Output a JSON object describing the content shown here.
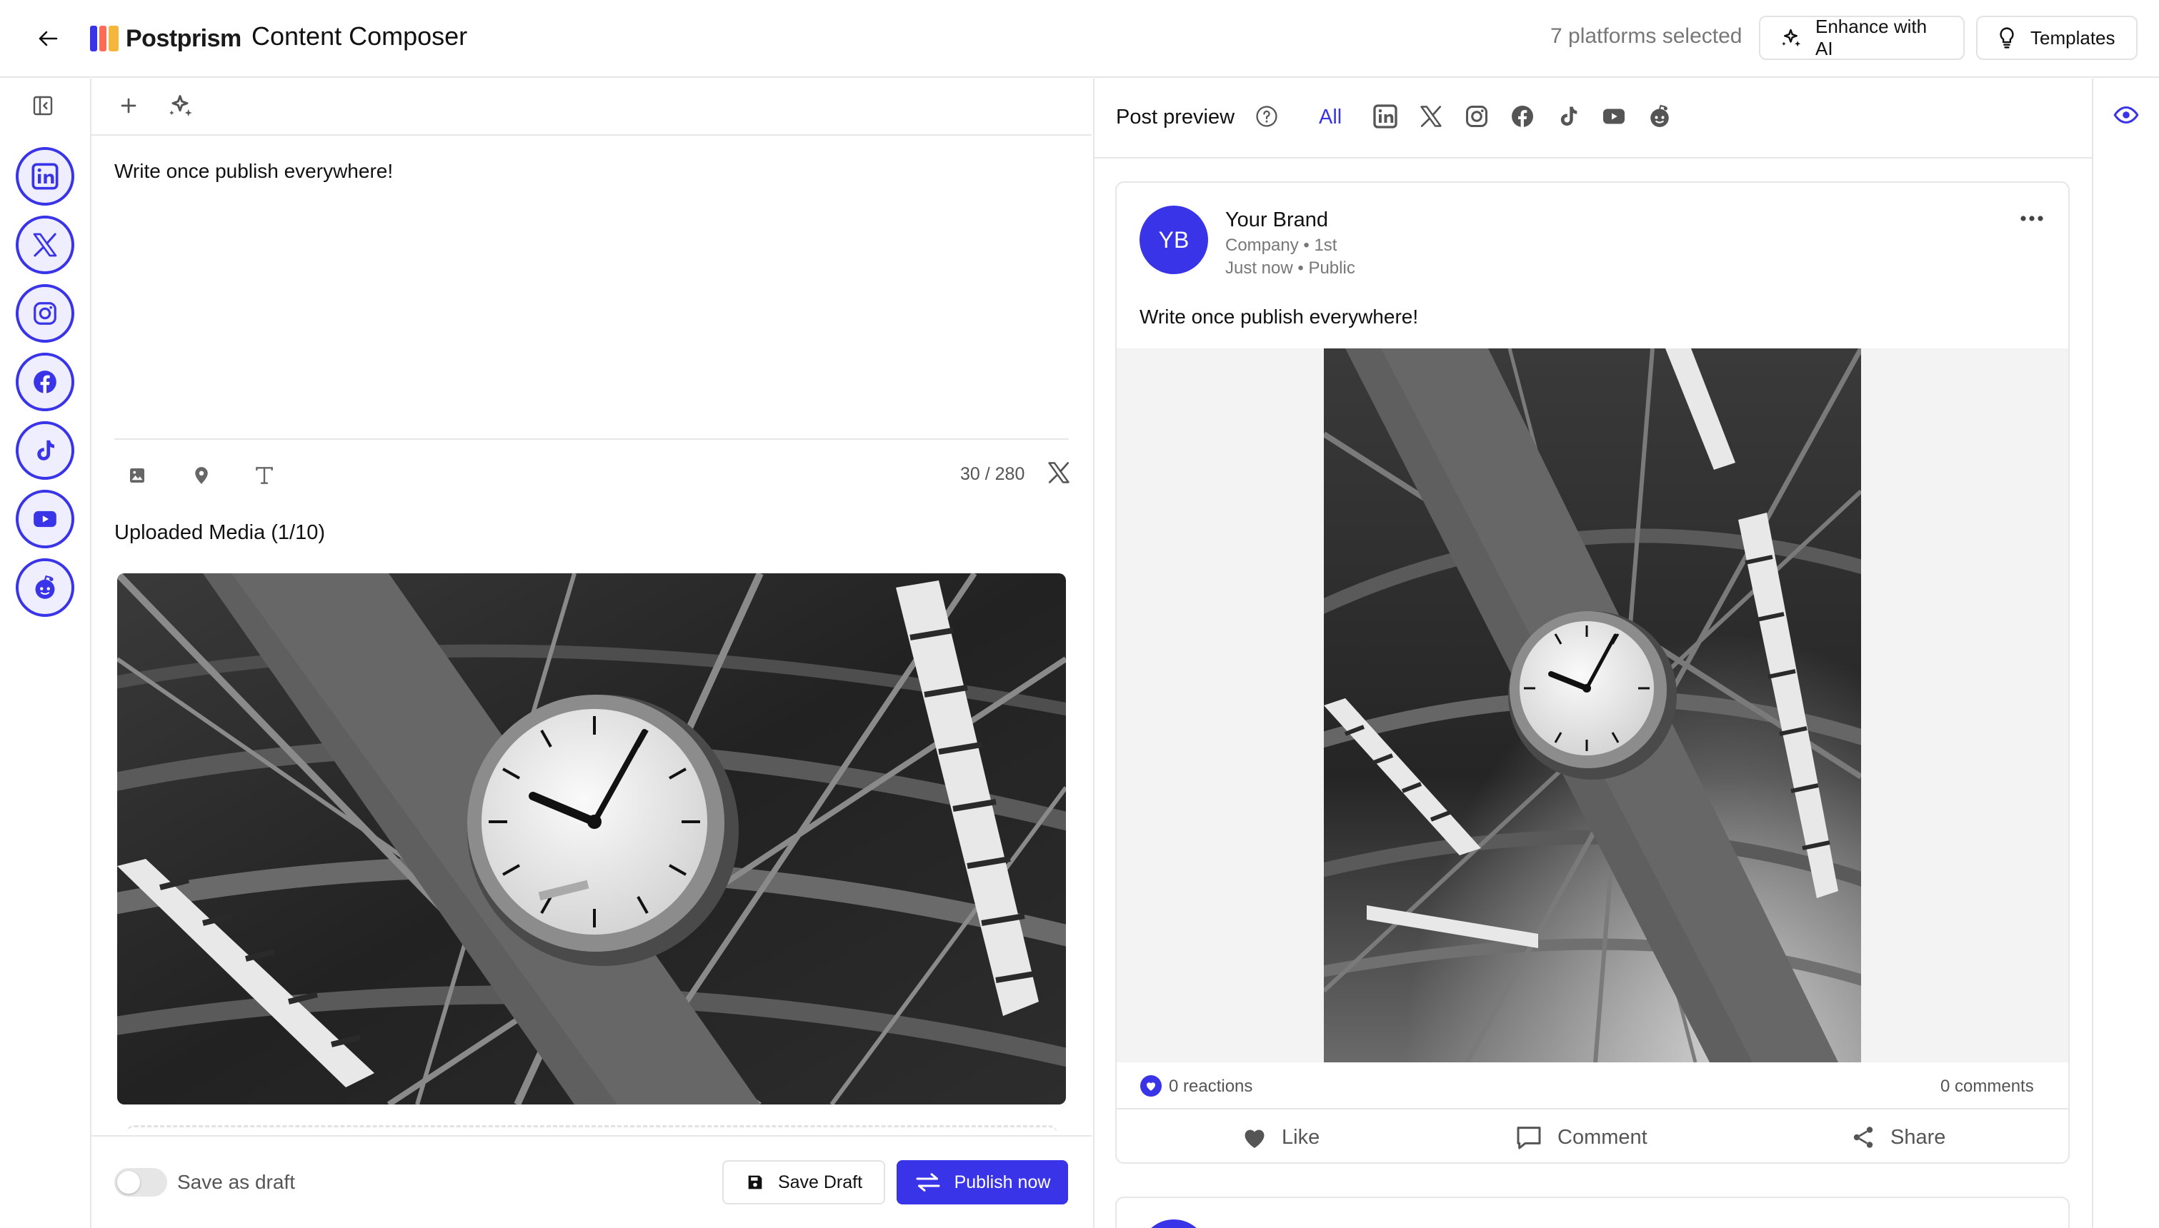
{
  "header": {
    "app_name": "Postprism",
    "page_title": "Content Composer",
    "platforms_selected": "7 platforms selected",
    "enhance_label": "Enhance with AI",
    "templates_label": "Templates"
  },
  "platforms": [
    "linkedin-icon",
    "x-icon",
    "instagram-icon",
    "facebook-icon",
    "tiktok-icon",
    "youtube-icon",
    "reddit-icon"
  ],
  "composer": {
    "text": "Write once publish everywhere!",
    "char_count": "30 / 280",
    "media_heading": "Uploaded Media (1/10)",
    "tools": [
      "image-icon",
      "location-icon",
      "text-format-icon"
    ]
  },
  "footer": {
    "save_as_draft": "Save as draft",
    "save_draft": "Save Draft",
    "publish_now": "Publish now"
  },
  "preview": {
    "title": "Post preview",
    "filter_all": "All",
    "filters": [
      "linkedin-icon",
      "x-icon",
      "instagram-icon",
      "facebook-icon",
      "tiktok-icon",
      "youtube-icon",
      "reddit-icon"
    ]
  },
  "post": {
    "avatar_initials": "YB",
    "author_name": "Your Brand",
    "meta_line1": "Company • 1st",
    "meta_line2": "Just now • Public",
    "text": "Write once publish everywhere!",
    "reactions": "0 reactions",
    "comments": "0 comments",
    "like": "Like",
    "comment": "Comment",
    "share": "Share"
  },
  "colors": {
    "accent": "#3a34e8",
    "logo_bars": [
      "#3a34e8",
      "#ff6b57",
      "#f5b63e"
    ]
  }
}
